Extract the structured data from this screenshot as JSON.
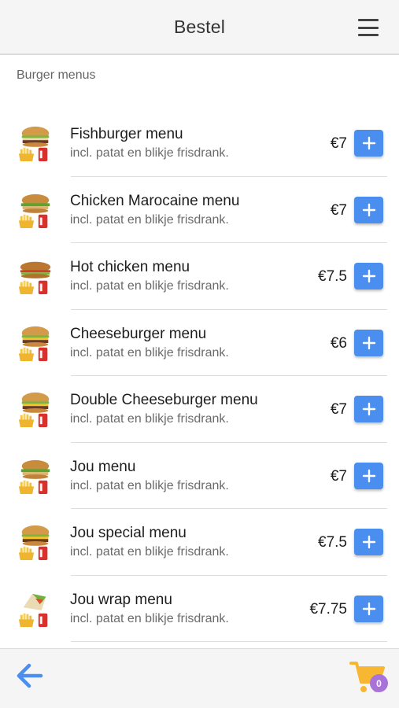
{
  "header": {
    "title": "Bestel",
    "menu_icon": "hamburger-menu-icon"
  },
  "section": {
    "label": "Burger menus"
  },
  "items": [
    {
      "name": "Fishburger menu",
      "desc": "incl. patat en blikje frisdrank.",
      "price": "€7",
      "thumb": "burger"
    },
    {
      "name": "Chicken Marocaine menu",
      "desc": "incl. patat en blikje frisdrank.",
      "price": "€7",
      "thumb": "chicken"
    },
    {
      "name": "Hot chicken menu",
      "desc": "incl. patat en blikje frisdrank.",
      "price": "€7.5",
      "thumb": "hotchicken"
    },
    {
      "name": "Cheeseburger menu",
      "desc": "incl. patat en blikje frisdrank.",
      "price": "€6",
      "thumb": "cheese"
    },
    {
      "name": "Double Cheeseburger menu",
      "desc": "incl. patat en blikje frisdrank.",
      "price": "€7",
      "thumb": "cheese"
    },
    {
      "name": "Jou menu",
      "desc": "incl. patat en blikje frisdrank.",
      "price": "€7",
      "thumb": "chicken"
    },
    {
      "name": "Jou special menu",
      "desc": "incl. patat en blikje frisdrank.",
      "price": "€7.5",
      "thumb": "cheese"
    },
    {
      "name": "Jou wrap menu",
      "desc": "incl. patat en blikje frisdrank.",
      "price": "€7.75",
      "thumb": "wrap"
    }
  ],
  "footer": {
    "back_icon": "arrow-left-icon",
    "cart_icon": "shopping-cart-icon",
    "cart_count": "0"
  },
  "colors": {
    "accent": "#4a8ff0",
    "cart": "#f7b733",
    "badge": "#a873d8"
  }
}
